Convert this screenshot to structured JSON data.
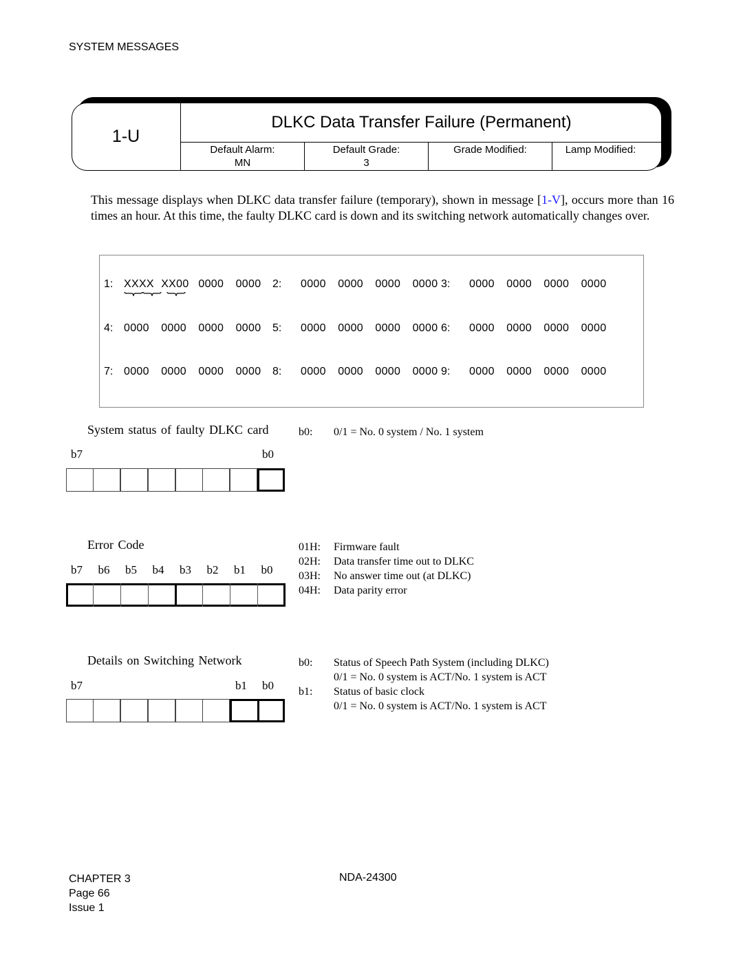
{
  "header": {
    "section": "SYSTEM MESSAGES"
  },
  "message": {
    "code": "1-U",
    "title": "DLKC Data Transfer Failure (Permanent)",
    "attributes": [
      {
        "label": "Default Alarm:",
        "value": "MN"
      },
      {
        "label": "Default Grade:",
        "value": "3"
      },
      {
        "label": "Grade Modified:",
        "value": ""
      },
      {
        "label": "Lamp Modified:",
        "value": ""
      }
    ]
  },
  "description": {
    "before_link": "This message displays when DLKC data transfer failure (temporary), shown in message [",
    "link_text": "1-V",
    "after_link": "], occurs more than 16 times an hour. At this time, the faulty DLKC card is down and its switching network automatically changes over.",
    "link_color": "#1a1aff"
  },
  "data_rows": [
    [
      {
        "label": "1:",
        "words": [
          "XXXX",
          "XX00",
          "0000",
          "0000"
        ]
      },
      {
        "label": "2:",
        "words": [
          "0000",
          "0000",
          "0000",
          "0000"
        ]
      },
      {
        "label": "3:",
        "words": [
          "0000",
          "0000",
          "0000",
          "0000"
        ]
      }
    ],
    [
      {
        "label": "4:",
        "words": [
          "0000",
          "0000",
          "0000",
          "0000"
        ]
      },
      {
        "label": "5:",
        "words": [
          "0000",
          "0000",
          "0000",
          "0000"
        ]
      },
      {
        "label": "6:",
        "words": [
          "0000",
          "0000",
          "0000",
          "0000"
        ]
      }
    ],
    [
      {
        "label": "7:",
        "words": [
          "0000",
          "0000",
          "0000",
          "0000"
        ]
      },
      {
        "label": "8:",
        "words": [
          "0000",
          "0000",
          "0000",
          "0000"
        ]
      },
      {
        "label": "9:",
        "words": [
          "0000",
          "0000",
          "0000",
          "0000"
        ]
      }
    ]
  ],
  "fields": [
    {
      "title": "System status of faulty DLKC card",
      "bit_labels": [
        "b7",
        "b0"
      ],
      "descriptions": [
        {
          "key": "b0:",
          "text": "0/1 = No. 0 system / No. 1 system"
        }
      ]
    },
    {
      "title": "Error Code",
      "bit_labels": [
        "b7",
        "b6",
        "b5",
        "b4",
        "b3",
        "b2",
        "b1",
        "b0"
      ],
      "descriptions": [
        {
          "key": "01H:",
          "text": "Firmware fault"
        },
        {
          "key": "02H:",
          "text": "Data transfer time out to DLKC"
        },
        {
          "key": "03H:",
          "text": "No answer time out (at DLKC)"
        },
        {
          "key": "04H:",
          "text": "Data parity error"
        }
      ]
    },
    {
      "title": "Details on Switching Network",
      "bit_labels": [
        "b7",
        "b1",
        "b0"
      ],
      "descriptions": [
        {
          "key": "b0:",
          "text": "Status of Speech Path System (including DLKC)"
        },
        {
          "key": "",
          "text": "0/1 = No. 0 system is ACT/No. 1 system is ACT"
        },
        {
          "key": "b1:",
          "text": "Status of basic clock"
        },
        {
          "key": "",
          "text": "0/1 = No. 0 system is ACT/No. 1 system is ACT"
        }
      ]
    }
  ],
  "footer": {
    "chapter": "CHAPTER 3",
    "page": "Page 66",
    "issue": "Issue 1",
    "doc_number": "NDA-24300"
  }
}
